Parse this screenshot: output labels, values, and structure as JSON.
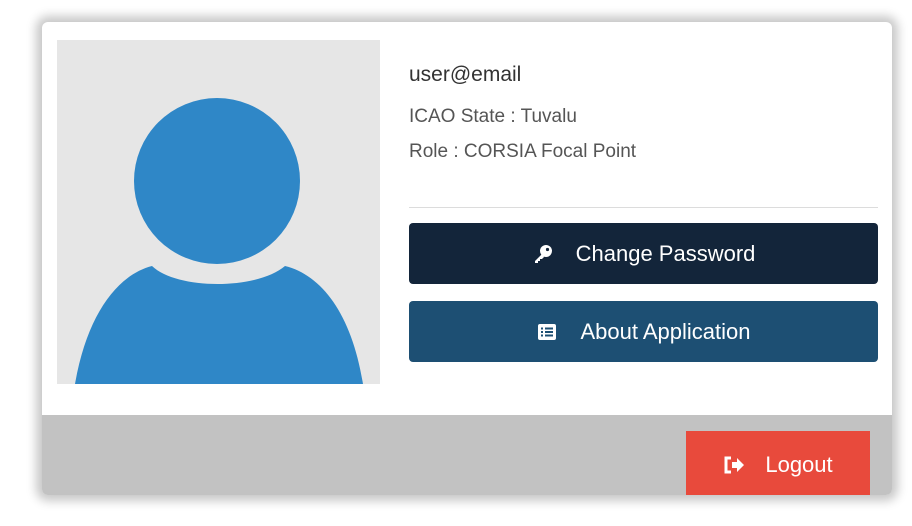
{
  "user": {
    "email": "user@email",
    "state_line": "ICAO State : Tuvalu",
    "role_line": "Role : CORSIA Focal Point"
  },
  "actions": {
    "change_password_label": "Change Password",
    "change_password_icon": "key-icon",
    "about_label": "About Application",
    "about_icon": "list-icon"
  },
  "footer": {
    "logout_label": "Logout",
    "logout_icon": "sign-out-icon"
  },
  "colors": {
    "avatar_bg": "#e6e6e6",
    "avatar_fill": "#2f87c7",
    "change_password_bg": "#13253a",
    "about_bg": "#1d4f73",
    "footer_bg": "#c2c2c2",
    "logout_bg": "#e84a3c"
  }
}
